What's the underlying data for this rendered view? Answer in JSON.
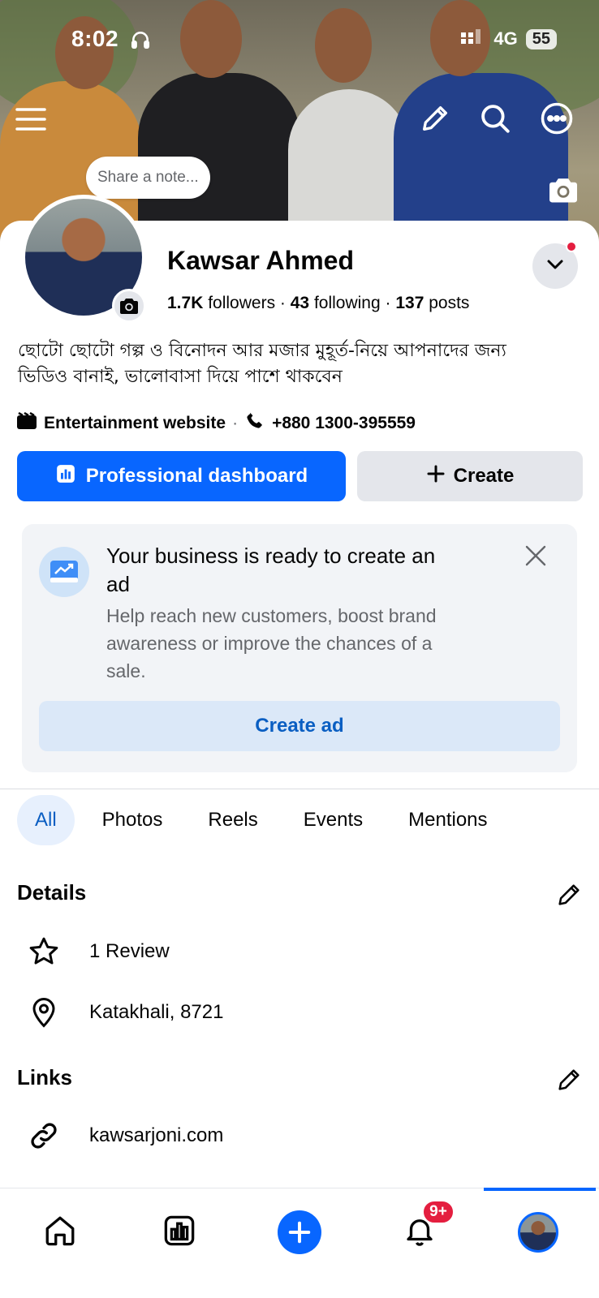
{
  "status_bar": {
    "time": "8:02",
    "network": "4G",
    "battery": "55"
  },
  "header": {
    "note_placeholder": "Share a note..."
  },
  "profile": {
    "name": "Kawsar Ahmed",
    "followers_count": "1.7K",
    "followers_label": "followers",
    "following_count": "43",
    "following_label": "following",
    "posts_count": "137",
    "posts_label": "posts",
    "bio_line1": "ছোটো ছোটো গল্প ও বিনোদন আর মজার মুহূর্ত-নিয়ে আপনাদের জন্য",
    "bio_line2": "ভিডিও বানাই, ভালোবাসা দিয়ে পাশে থাকবেন",
    "category": "Entertainment website",
    "phone": "+880 1300-395559"
  },
  "actions": {
    "dashboard_label": "Professional dashboard",
    "create_label": "Create"
  },
  "ad_prompt": {
    "title_line1": "Your business is ready to create an",
    "title_line2": "ad",
    "text_line1": "Help reach new customers, boost brand",
    "text_line2": "awareness or improve the chances of a",
    "text_line3": "sale.",
    "button_label": "Create ad"
  },
  "tabs": [
    {
      "label": "All",
      "active": true
    },
    {
      "label": "Photos"
    },
    {
      "label": "Reels"
    },
    {
      "label": "Events"
    },
    {
      "label": "Mentions"
    }
  ],
  "details": {
    "title": "Details",
    "review": "1 Review",
    "location": "Katakhali, 8721"
  },
  "links": {
    "title": "Links",
    "website": "kawsarjoni.com"
  },
  "bottom_nav": {
    "notifications_badge": "9+"
  },
  "colors": {
    "primary": "#0866ff",
    "badge": "#e41e3f",
    "secondary_bg": "#e4e6eb"
  }
}
